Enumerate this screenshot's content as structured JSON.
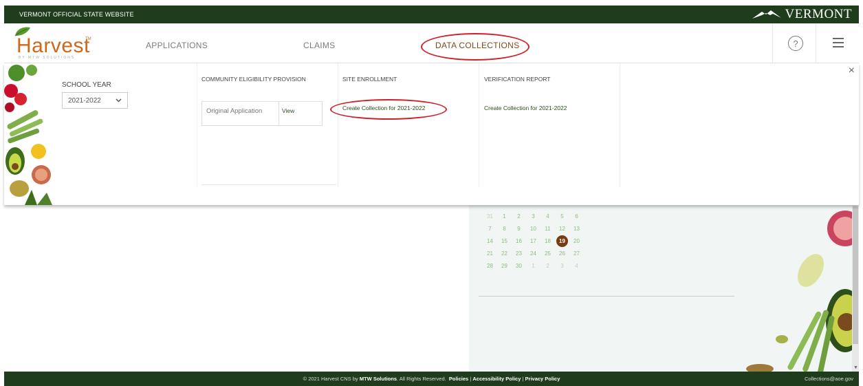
{
  "topbar": {
    "state_site": "VERMONT OFFICIAL STATE WEBSITE",
    "vermont_logo": "VERMONT"
  },
  "brand": {
    "name": "Harvest",
    "tm": "TM",
    "sub": "BY MTW SOLUTIONS"
  },
  "nav": {
    "applications": "APPLICATIONS",
    "claims": "CLAIMS",
    "data_collections": "DATA COLLECTIONS",
    "help": "?"
  },
  "mega": {
    "close": "×",
    "school_year": {
      "label": "SCHOOL YEAR",
      "value": "2021-2022"
    },
    "cep": {
      "heading": "COMMUNITY ELIGIBILITY PROVISION",
      "row_label": "Original Application",
      "row_action": "View"
    },
    "site_enrollment": {
      "heading": "SITE ENROLLMENT",
      "link": "Create Collection for 2021-2022"
    },
    "verification": {
      "heading": "VERIFICATION REPORT",
      "link": "Create Collection for 2021-2022"
    }
  },
  "calendar": {
    "weeks": [
      [
        "31",
        "1",
        "2",
        "3",
        "4",
        "5",
        "6"
      ],
      [
        "7",
        "8",
        "9",
        "10",
        "11",
        "12",
        "13"
      ],
      [
        "14",
        "15",
        "16",
        "17",
        "18",
        "19",
        "20"
      ],
      [
        "21",
        "22",
        "23",
        "24",
        "25",
        "26",
        "27"
      ],
      [
        "28",
        "29",
        "30",
        "1",
        "2",
        "3",
        "4"
      ]
    ],
    "today": "19"
  },
  "footer": {
    "copyright": "© 2021 Harvest CNS by",
    "company": "MTW Solutions",
    "rights": ". All Rights Reserved.",
    "policies": "Policies",
    "accessibility": "Accessibility Policy",
    "privacy": "Privacy Policy",
    "email": "Collections@aoe.gov"
  },
  "colors": {
    "dark_green": "#1f3d1d",
    "brand_orange": "#c96a1d",
    "annotation_red": "#d02027",
    "today_brown": "#7a3a0d"
  }
}
